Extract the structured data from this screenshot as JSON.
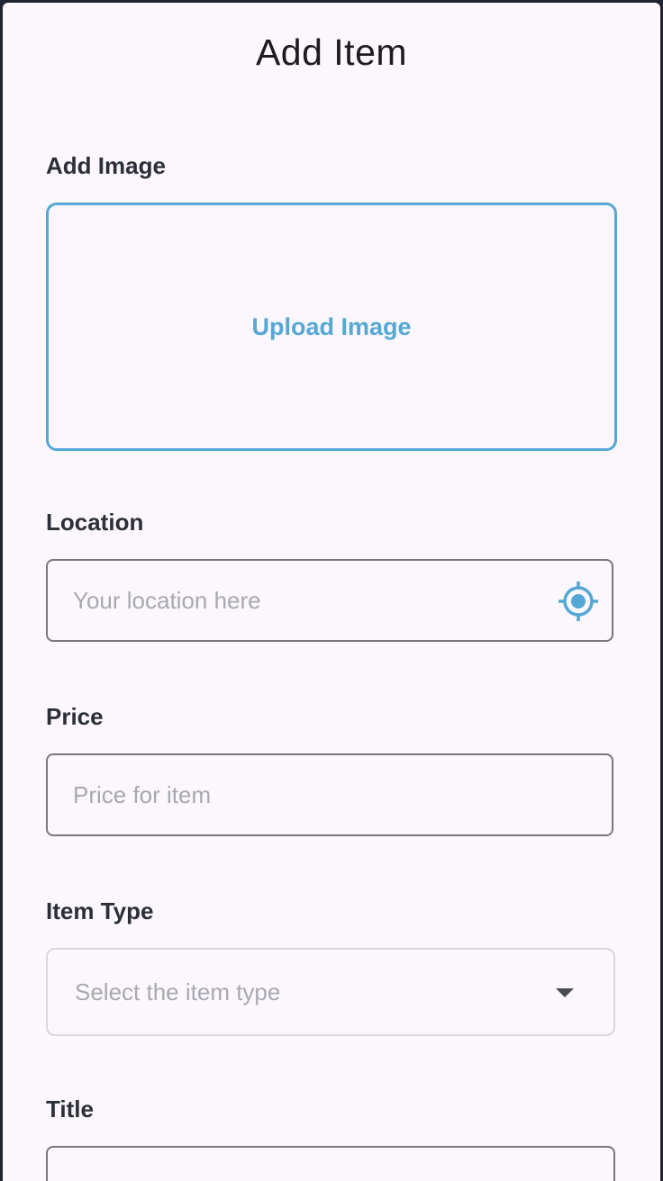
{
  "header": {
    "title": "Add Item"
  },
  "image_section": {
    "label": "Add Image",
    "upload_label": "Upload Image"
  },
  "location": {
    "label": "Location",
    "placeholder": "Your location here",
    "value": ""
  },
  "price": {
    "label": "Price",
    "placeholder": "Price for item",
    "value": ""
  },
  "item_type": {
    "label": "Item Type",
    "placeholder": "Select the item type"
  },
  "title_field": {
    "label": "Title",
    "value": ""
  },
  "colors": {
    "accent": "#55a7d6",
    "background": "#fcf7fc",
    "border": "#7a767d"
  }
}
